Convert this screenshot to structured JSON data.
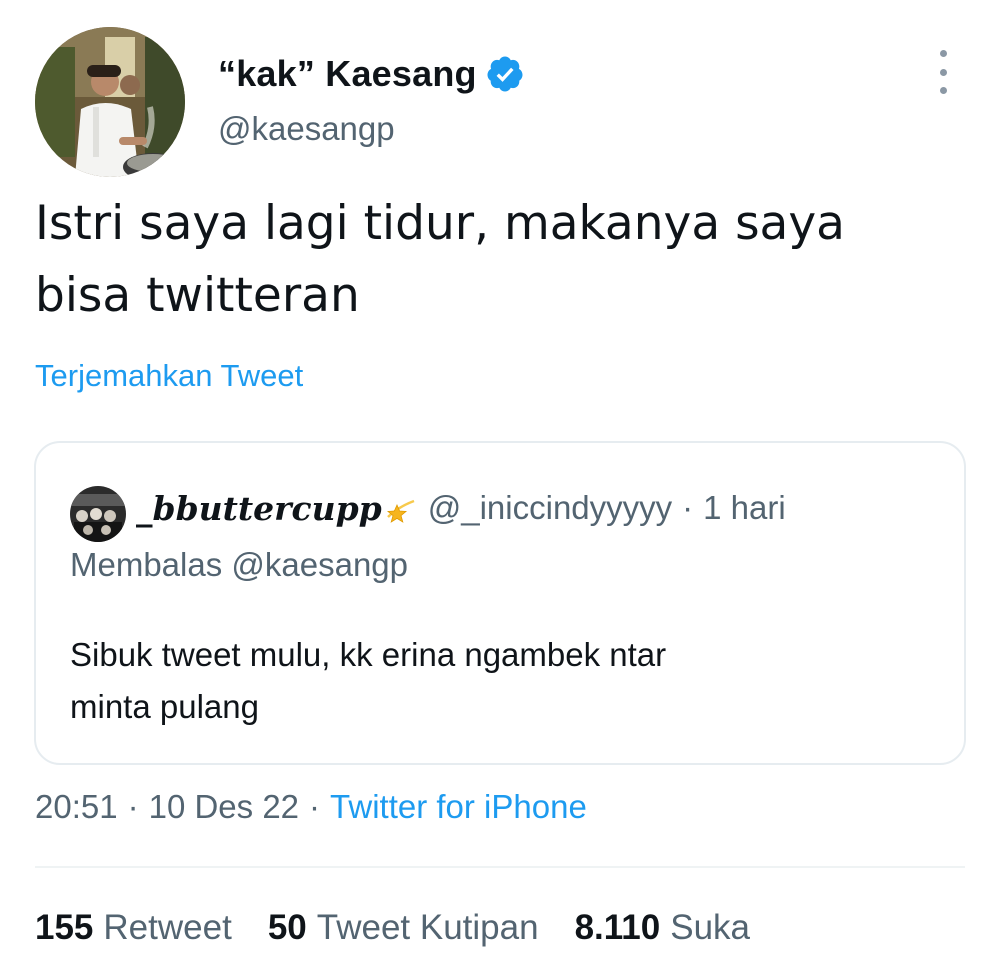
{
  "author": {
    "display_name": "“kak” Kaesang",
    "handle": "@kaesangp",
    "verified": true,
    "avatar": "chef-cooking-photo"
  },
  "tweet": {
    "text_line1": "Istri saya lagi tidur, makanya saya",
    "text_line2": "bisa twitteran",
    "translate_label": "Terjemahkan Tweet"
  },
  "quote": {
    "name": "_bbuttercupp",
    "name_emoji": "star-emoji",
    "handle": "@_iniccindyyyyy",
    "separator": "·",
    "time": "1 hari",
    "replying_to": "Membalas @kaesangp",
    "text_line1": "Sibuk tweet mulu, kk erina ngambek ntar",
    "text_line2": "minta pulang"
  },
  "meta": {
    "time": "20:51",
    "sep1": "·",
    "date": "10 Des 22",
    "sep2": "·",
    "source": "Twitter for iPhone"
  },
  "stats": {
    "retweets": {
      "count": "155",
      "label": "Retweet"
    },
    "quotes": {
      "count": "50",
      "label": "Tweet Kutipan"
    },
    "likes": {
      "count": "8.110",
      "label": "Suka"
    }
  },
  "colors": {
    "link": "#1d9bf0",
    "secondary_text": "#536471",
    "primary_text": "#0f1419",
    "border": "#e6ecf0"
  }
}
